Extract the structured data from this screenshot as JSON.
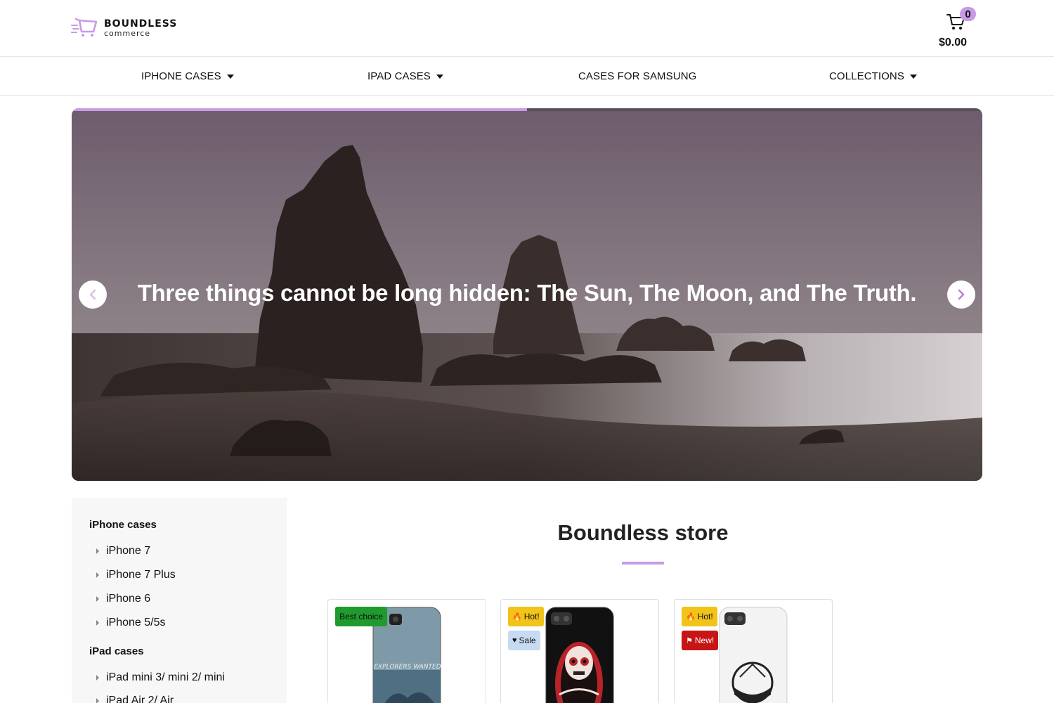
{
  "brand": {
    "title": "BOUNDLESS",
    "subtitle": "commerce",
    "accent": "#c79ae3"
  },
  "cart": {
    "count": "0",
    "total": "$0.00",
    "icon": "cart-icon"
  },
  "nav": {
    "items": [
      {
        "label": "IPHONE CASES",
        "has_dropdown": true
      },
      {
        "label": "IPAD CASES",
        "has_dropdown": true
      },
      {
        "label": "CASES FOR SAMSUNG",
        "has_dropdown": false
      },
      {
        "label": "COLLECTIONS",
        "has_dropdown": true
      }
    ]
  },
  "hero": {
    "quote": "Three things cannot be long hidden: The Sun, The Moon, and The Truth.",
    "progress": 0.5,
    "prev_icon": "chevron-left-icon",
    "next_icon": "chevron-right-icon"
  },
  "sidebar": {
    "groups": [
      {
        "heading": "iPhone cases",
        "items": [
          "iPhone 7",
          "iPhone 7 Plus",
          "iPhone 6",
          "iPhone 5/5s"
        ]
      },
      {
        "heading": "iPad cases",
        "items": [
          "iPad mini 3/ mini 2/ mini",
          "iPad Air 2/ Air"
        ]
      }
    ]
  },
  "store": {
    "title": "Boundless store"
  },
  "products": [
    {
      "badges": [
        {
          "label": "Best choice",
          "icon": "",
          "color": "#1f9b2e"
        }
      ],
      "case_text": "EXPLORERS WANTED"
    },
    {
      "badges": [
        {
          "label": "Hot!",
          "icon": "fire-icon",
          "color": "#f2c318"
        },
        {
          "label": "Sale",
          "icon": "heart-icon",
          "color": "#c6daf2"
        }
      ],
      "case_text": ""
    },
    {
      "badges": [
        {
          "label": "Hot!",
          "icon": "fire-icon",
          "color": "#f2c318"
        },
        {
          "label": "New!",
          "icon": "flag-icon",
          "color": "#c71515"
        }
      ],
      "case_text": ""
    }
  ]
}
